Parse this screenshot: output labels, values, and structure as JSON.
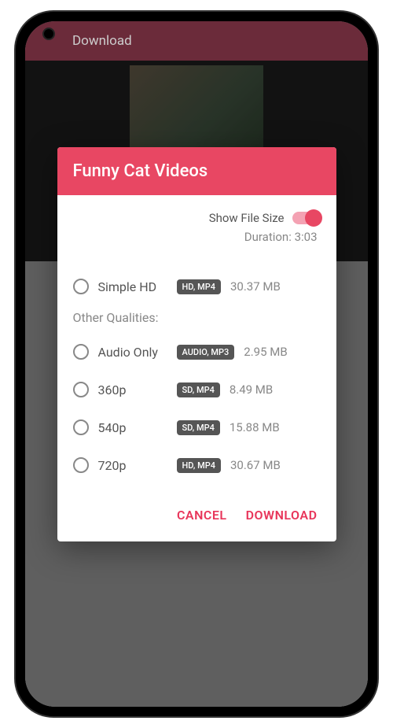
{
  "appBar": {
    "title": "Download"
  },
  "dialog": {
    "title": "Funny Cat Videos",
    "showFileSizeLabel": "Show File Size",
    "durationLabel": "Duration: 3:03",
    "otherQualitiesLabel": "Other Qualities:",
    "options": [
      {
        "label": "Simple HD",
        "format": "HD, MP4",
        "size": "30.37 MB"
      },
      {
        "label": "Audio Only",
        "format": "AUDIO, MP3",
        "size": "2.95 MB"
      },
      {
        "label": "360p",
        "format": "SD, MP4",
        "size": "8.49 MB"
      },
      {
        "label": "540p",
        "format": "SD, MP4",
        "size": "15.88 MB"
      },
      {
        "label": "720p",
        "format": "HD, MP4",
        "size": "30.67 MB"
      }
    ],
    "actions": {
      "cancel": "CANCEL",
      "download": "DOWNLOAD"
    }
  }
}
